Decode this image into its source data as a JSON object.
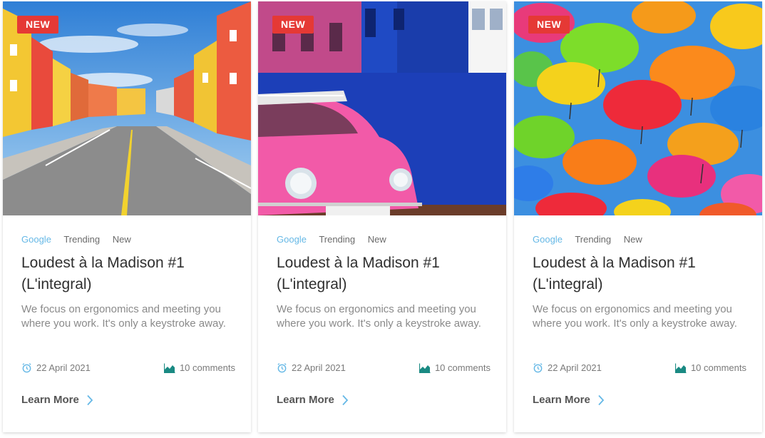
{
  "colors": {
    "badge": "#e53935",
    "accent": "#65b8e6",
    "icon_teal": "#1a8a83",
    "text": "#2f2f2f"
  },
  "cards": [
    {
      "badge": "NEW",
      "image": "colorful-street-houses",
      "tags": [
        "Google",
        "Trending",
        "New"
      ],
      "title": "Loudest à la Madison #1 (L'integral)",
      "description": "We focus on ergonomics and meeting you where you work. It's only a keystroke away.",
      "date": "22 April 2021",
      "comments": "10 comments",
      "link": "Learn More"
    },
    {
      "badge": "NEW",
      "image": "pink-car-blue-wall",
      "tags": [
        "Google",
        "Trending",
        "New"
      ],
      "title": "Loudest à la Madison #1 (L'integral)",
      "description": "We focus on ergonomics and meeting you where you work. It's only a keystroke away.",
      "date": "22 April 2021",
      "comments": "10 comments",
      "link": "Learn More"
    },
    {
      "badge": "NEW",
      "image": "colorful-umbrellas",
      "tags": [
        "Google",
        "Trending",
        "New"
      ],
      "title": "Loudest à la Madison #1 (L'integral)",
      "description": "We focus on ergonomics and meeting you where you work. It's only a keystroke away.",
      "date": "22 April 2021",
      "comments": "10 comments",
      "link": "Learn More"
    }
  ]
}
